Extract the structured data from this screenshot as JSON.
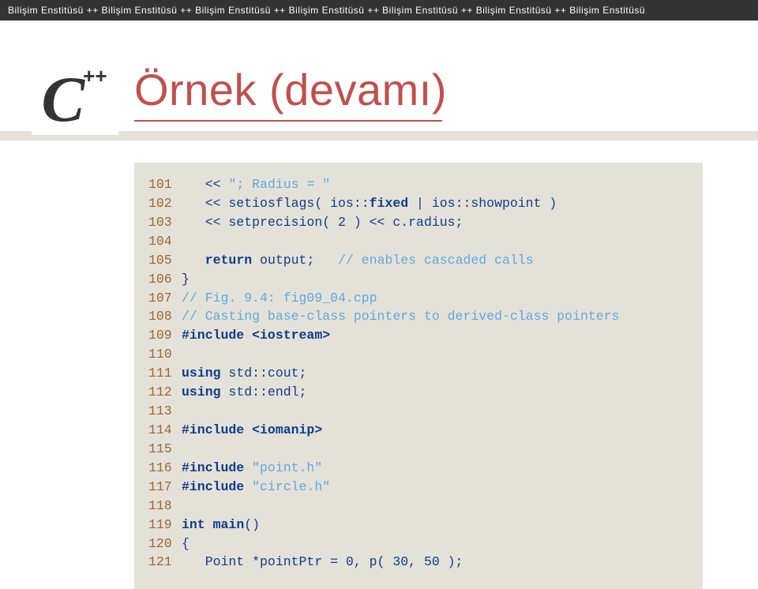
{
  "header": {
    "item": "Bilişim Enstitüsü",
    "sep": "++",
    "count": 7
  },
  "logo": {
    "c": "C",
    "plus": "++"
  },
  "title": "Örnek (devamı)",
  "code": {
    "lines": [
      {
        "n": "101",
        "segs": [
          {
            "cls": "seg-text",
            "t": "   << "
          },
          {
            "cls": "seg-light",
            "t": "\"; Radius = \""
          }
        ]
      },
      {
        "n": "102",
        "segs": [
          {
            "cls": "seg-text",
            "t": "   << setiosflags( ios::"
          },
          {
            "cls": "seg-kw",
            "t": "fixed"
          },
          {
            "cls": "seg-text",
            "t": " | ios::showpoint )"
          }
        ]
      },
      {
        "n": "103",
        "segs": [
          {
            "cls": "seg-text",
            "t": "   << setprecision( 2 ) << c.radius;"
          }
        ]
      },
      {
        "n": "104",
        "segs": []
      },
      {
        "n": "105",
        "segs": [
          {
            "cls": "seg-text",
            "t": "   "
          },
          {
            "cls": "seg-kw",
            "t": "return"
          },
          {
            "cls": "seg-text",
            "t": " output;   "
          },
          {
            "cls": "seg-comment",
            "t": "// enables cascaded calls"
          }
        ]
      },
      {
        "n": "106",
        "segs": [
          {
            "cls": "seg-text",
            "t": "}"
          }
        ]
      },
      {
        "n": "107",
        "segs": [
          {
            "cls": "seg-comment",
            "t": "// Fig. 9.4: fig09_04.cpp"
          }
        ]
      },
      {
        "n": "108",
        "segs": [
          {
            "cls": "seg-comment",
            "t": "// Casting base-class pointers to derived-class pointers"
          }
        ]
      },
      {
        "n": "109",
        "segs": [
          {
            "cls": "seg-pp",
            "t": "#include <iostream>"
          }
        ]
      },
      {
        "n": "110",
        "segs": []
      },
      {
        "n": "111",
        "segs": [
          {
            "cls": "seg-kw",
            "t": "using"
          },
          {
            "cls": "seg-text",
            "t": " std::cout;"
          }
        ]
      },
      {
        "n": "112",
        "segs": [
          {
            "cls": "seg-kw",
            "t": "using"
          },
          {
            "cls": "seg-text",
            "t": " std::endl;"
          }
        ]
      },
      {
        "n": "113",
        "segs": []
      },
      {
        "n": "114",
        "segs": [
          {
            "cls": "seg-pp",
            "t": "#include <iomanip>"
          }
        ]
      },
      {
        "n": "115",
        "segs": []
      },
      {
        "n": "116",
        "segs": [
          {
            "cls": "seg-pp",
            "t": "#include "
          },
          {
            "cls": "seg-light",
            "t": "\"point.h\""
          }
        ]
      },
      {
        "n": "117",
        "segs": [
          {
            "cls": "seg-pp",
            "t": "#include "
          },
          {
            "cls": "seg-light",
            "t": "\"circle.h\""
          }
        ]
      },
      {
        "n": "118",
        "segs": []
      },
      {
        "n": "119",
        "segs": [
          {
            "cls": "seg-kw",
            "t": "int"
          },
          {
            "cls": "seg-text",
            "t": " "
          },
          {
            "cls": "seg-fn",
            "t": "main"
          },
          {
            "cls": "seg-text",
            "t": "()"
          }
        ]
      },
      {
        "n": "120",
        "segs": [
          {
            "cls": "seg-text",
            "t": "{"
          }
        ]
      },
      {
        "n": "121",
        "segs": [
          {
            "cls": "seg-text",
            "t": "   Point *pointPtr = 0, p( 30, 50 );"
          }
        ]
      }
    ]
  }
}
